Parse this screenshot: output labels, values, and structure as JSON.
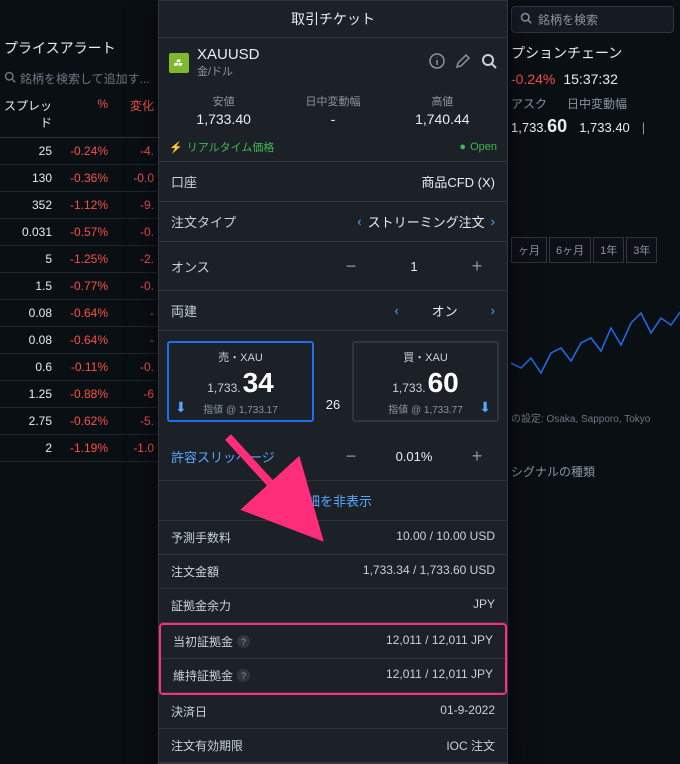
{
  "bg": {
    "alert_title": "プライスアラート",
    "search_placeholder": "銘柄を検索して追加す...",
    "head": {
      "c1": "スプレッド",
      "c2": "%",
      "c3": "変化"
    },
    "rows": [
      {
        "v": "25",
        "p": "-0.24%",
        "c": "-4."
      },
      {
        "v": "130",
        "p": "-0.36%",
        "c": "-0.0"
      },
      {
        "v": "352",
        "p": "-1.12%",
        "c": "-9."
      },
      {
        "v": "0.031",
        "p": "-0.57%",
        "c": "-0."
      },
      {
        "v": "5",
        "p": "-1.25%",
        "c": "-2."
      },
      {
        "v": "1.5",
        "p": "-0.77%",
        "c": "-0."
      },
      {
        "v": "0.08",
        "p": "-0.64%",
        "c": "-"
      },
      {
        "v": "0.08",
        "p": "-0.64%",
        "c": "-"
      },
      {
        "v": "0.6",
        "p": "-0.11%",
        "c": "-0."
      },
      {
        "v": "1.25",
        "p": "-0.88%",
        "c": "-6"
      },
      {
        "v": "2.75",
        "p": "-0.62%",
        "c": "-5."
      },
      {
        "v": "2",
        "p": "-1.19%",
        "c": "-1.0"
      }
    ],
    "right_search": "銘柄を検索",
    "opt_chain": "プションチェーン",
    "pct": "-0.24%",
    "time": "15:37:32",
    "ask_label": "アスク",
    "range_label": "日中変動幅",
    "ask_val": "1,733.",
    "ask_big": "60",
    "range_val": "1,733.40",
    "tabs": [
      "ヶ月",
      "6ヶ月",
      "1年",
      "3年"
    ],
    "chart_note": "の設定: Osaka, Sapporo, Tokyo",
    "signal": "シグナルの種類"
  },
  "ticket": {
    "title": "取引チケット",
    "symbol": "XAUUSD",
    "symbol_sub": "金/ドル",
    "low_label": "安値",
    "low": "1,733.40",
    "range_label": "日中変動幅",
    "range": "-",
    "high_label": "高値",
    "high": "1,740.44",
    "realtime": "リアルタイム価格",
    "open": "Open",
    "account_label": "口座",
    "account_val": "商品CFD (X)",
    "order_type_label": "注文タイプ",
    "order_type_val": "ストリーミング注文",
    "qty_label": "オンス",
    "qty_val": "1",
    "hedge_label": "両建",
    "hedge_val": "オン",
    "sell_label": "売・XAU",
    "sell_small": "1,733.",
    "sell_big": "34",
    "sell_sub": "指値 @ 1,733.17",
    "spread": "26",
    "buy_label": "買・XAU",
    "buy_small": "1,733.",
    "buy_big": "60",
    "buy_sub": "指値 @ 1,733.77",
    "slip_label": "許容スリッページ",
    "slip_val": "0.01%",
    "detail_toggle": "詳細を非表示",
    "details": {
      "fee_label": "予測手数料",
      "fee_val": "10.00 / 10.00 USD",
      "amt_label": "注文金額",
      "amt_val": "1,733.34 / 1,733.60 USD",
      "margin_avail_label": "証拠金余力",
      "margin_avail_val": "JPY",
      "init_margin_label": "当初証拠金",
      "init_margin_val": "12,011 / 12,011 JPY",
      "maint_margin_label": "維持証拠金",
      "maint_margin_val": "12,011 / 12,011 JPY",
      "settle_label": "決済日",
      "settle_val": "01-9-2022",
      "expiry_label": "注文有効期限",
      "expiry_val": "IOC 注文"
    }
  }
}
